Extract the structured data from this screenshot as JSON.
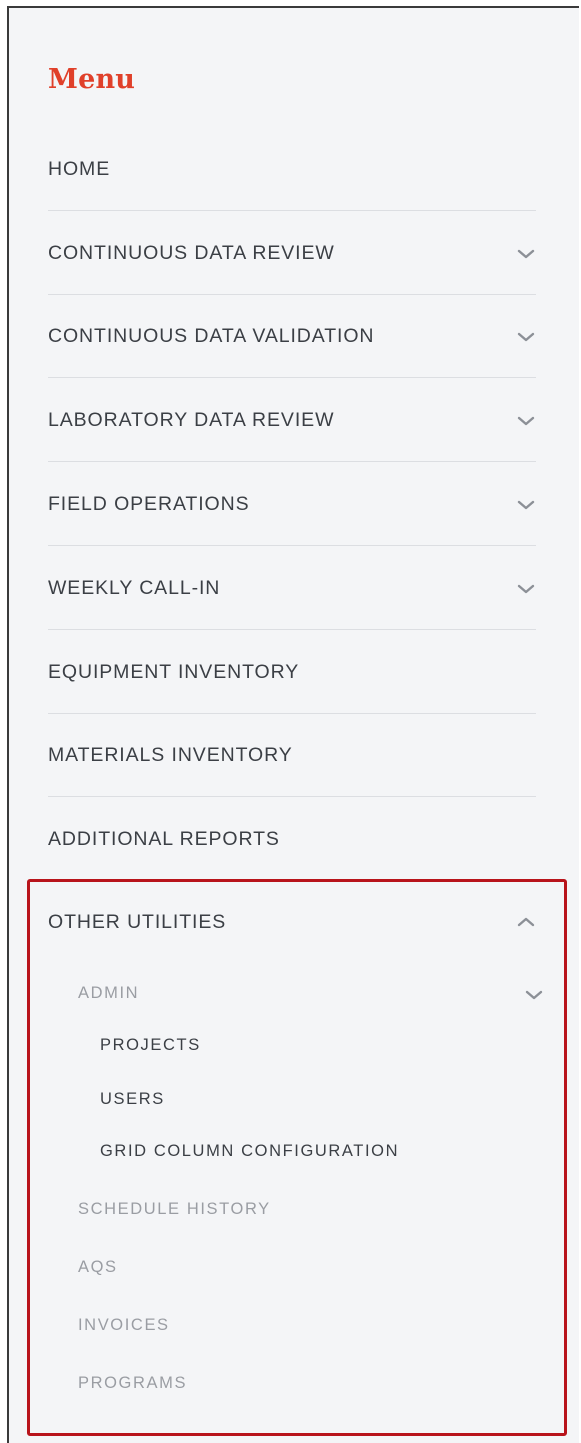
{
  "menu": {
    "title": "Menu",
    "items": [
      {
        "label": "HOME",
        "has_chevron": false
      },
      {
        "label": "CONTINUOUS DATA REVIEW",
        "has_chevron": true,
        "chevron": "chevron-down-icon"
      },
      {
        "label": "CONTINUOUS DATA VALIDATION",
        "has_chevron": true,
        "chevron": "chevron-down-icon"
      },
      {
        "label": "LABORATORY DATA REVIEW",
        "has_chevron": true,
        "chevron": "chevron-down-icon"
      },
      {
        "label": "FIELD OPERATIONS",
        "has_chevron": true,
        "chevron": "chevron-down-icon"
      },
      {
        "label": "WEEKLY CALL-IN",
        "has_chevron": true,
        "chevron": "chevron-down-icon"
      },
      {
        "label": "EQUIPMENT INVENTORY",
        "has_chevron": false
      },
      {
        "label": "MATERIALS INVENTORY",
        "has_chevron": false
      },
      {
        "label": "ADDITIONAL REPORTS",
        "has_chevron": false
      },
      {
        "label": "OTHER UTILITIES",
        "has_chevron": true,
        "chevron": "chevron-up-icon",
        "expanded": true
      }
    ],
    "other_utilities": {
      "admin": {
        "label": "ADMIN",
        "chevron": "chevron-down-icon",
        "children": [
          "PROJECTS",
          "USERS",
          "GRID COLUMN CONFIGURATION"
        ]
      },
      "schedule_history": "SCHEDULE HISTORY",
      "aqs": "AQS",
      "invoices": "INVOICES",
      "programs": "PROGRAMS"
    }
  },
  "colors": {
    "title_red": "#e0402a",
    "highlight_border": "#b8141b",
    "panel_bg": "#f4f5f7",
    "text_dark": "#3b3f45",
    "text_muted": "#9a9da3",
    "divider": "#dcdee2"
  }
}
